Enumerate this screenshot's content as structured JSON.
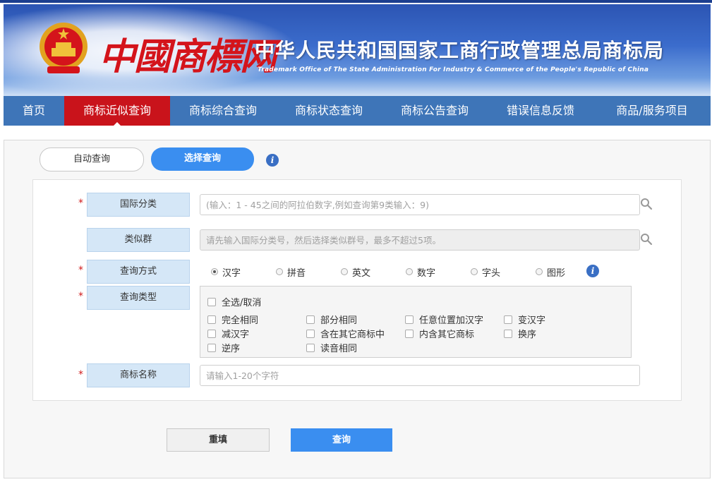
{
  "header": {
    "logo_text": "中國商標网",
    "title": "中华人民共和国国家工商行政管理总局商标局",
    "subtitle": "Trademark Office of The State Administration For Industry & Commerce of the People's Republic of China"
  },
  "nav": {
    "items": [
      {
        "label": "首页",
        "active": false
      },
      {
        "label": "商标近似查询",
        "active": true
      },
      {
        "label": "商标综合查询",
        "active": false
      },
      {
        "label": "商标状态查询",
        "active": false
      },
      {
        "label": "商标公告查询",
        "active": false
      },
      {
        "label": "错误信息反馈",
        "active": false
      },
      {
        "label": "商品/服务项目",
        "active": false
      }
    ]
  },
  "tabs": {
    "auto": "自动查询",
    "select": "选择查询",
    "active": "select"
  },
  "form": {
    "required_mark": "*",
    "intl_class": {
      "label": "国际分类",
      "placeholder": "(输入：1 - 45之间的阿拉伯数字,例如查询第9类输入：9)",
      "value": ""
    },
    "similar_group": {
      "label": "类似群",
      "placeholder": "请先输入国际分类号，然后选择类似群号，最多不超过5项。",
      "value": ""
    },
    "query_method": {
      "label": "查询方式",
      "options": [
        "汉字",
        "拼音",
        "英文",
        "数字",
        "字头",
        "图形"
      ],
      "selected": "汉字"
    },
    "query_type": {
      "label": "查询类型",
      "select_all": "全选/取消",
      "options": [
        "完全相同",
        "部分相同",
        "任意位置加汉字",
        "变汉字",
        "减汉字",
        "含在其它商标中",
        "内含其它商标",
        "换序",
        "逆序",
        "读音相同"
      ]
    },
    "trademark_name": {
      "label": "商标名称",
      "placeholder": "请输入1-20个字符",
      "value": ""
    }
  },
  "buttons": {
    "reset": "重填",
    "query": "查询"
  },
  "colors": {
    "nav_bg": "#3e75b8",
    "nav_active": "#c9131b",
    "primary_button": "#3a8ef0",
    "label_bg": "#d5e7f7",
    "required": "#d01b1b"
  }
}
